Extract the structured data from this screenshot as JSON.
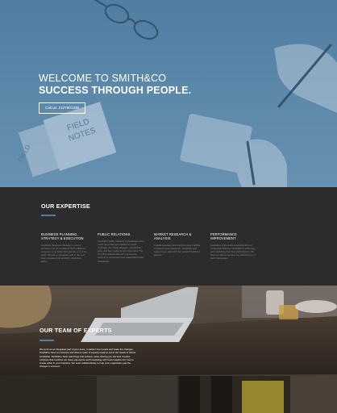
{
  "hero": {
    "title_line1": "WELCOME TO SMITH&CO",
    "title_line2": "SUCCESS THROUGH PEOPLE.",
    "call_button": "Call us: 2127901338"
  },
  "expertise": {
    "title": "OUR EXPERTISE",
    "columns": [
      {
        "title": "BUSINESS PLANNING, STRATEGY & EXECUTION",
        "text": "Smith&Co Business strategy is more a company can do to achieve their ambitious company to be better that just the sum of its parts. We are a companies and in the end that increases cost and ROI, distinctive within."
      },
      {
        "title": "PUBLIC RELATIONS",
        "text": "Smith&Co public relations professionals drive much more than just traditional media coverage, we create dialogue, stories that stick, and form public trust in the brand. The firm PR professionals with experience connect to consumers and stakeholders with campaigns."
      },
      {
        "title": "MARKET RESEARCH & ANALYSIS",
        "text": "Capital business cant improve using frontline consumer and experience. Smith&Co will support your data with the research behind a specific."
      },
      {
        "title": "PERFORMANCE IMPROVEMENT",
        "text": "Smith&Co is the basic consulting firm for companies that are committed to achieving and sustaining their best performance. We help our clients improve the performance of their businesses."
      }
    ]
  },
  "team": {
    "title": "OUR TEAM OF EXPERTS",
    "text": "We work as an integrated part of your team, to deliver true results and make the changes. Smith&Co have an inclusive and diverse team of experts ready to serve the needs of clients worldwide. Smith&Co have real things that achieve value offering you the best creative solutions that combine our deep experience and knowledge with fresh insights into how to create value in your business. We work collaboratively to help your organization get the change to succeed."
  },
  "colors": {
    "hero_blue": "#5b87a9",
    "dark_section": "#2c2c2c",
    "accent_rule": "#4f7ea2",
    "body_text_grey": "#8b8b8b"
  }
}
